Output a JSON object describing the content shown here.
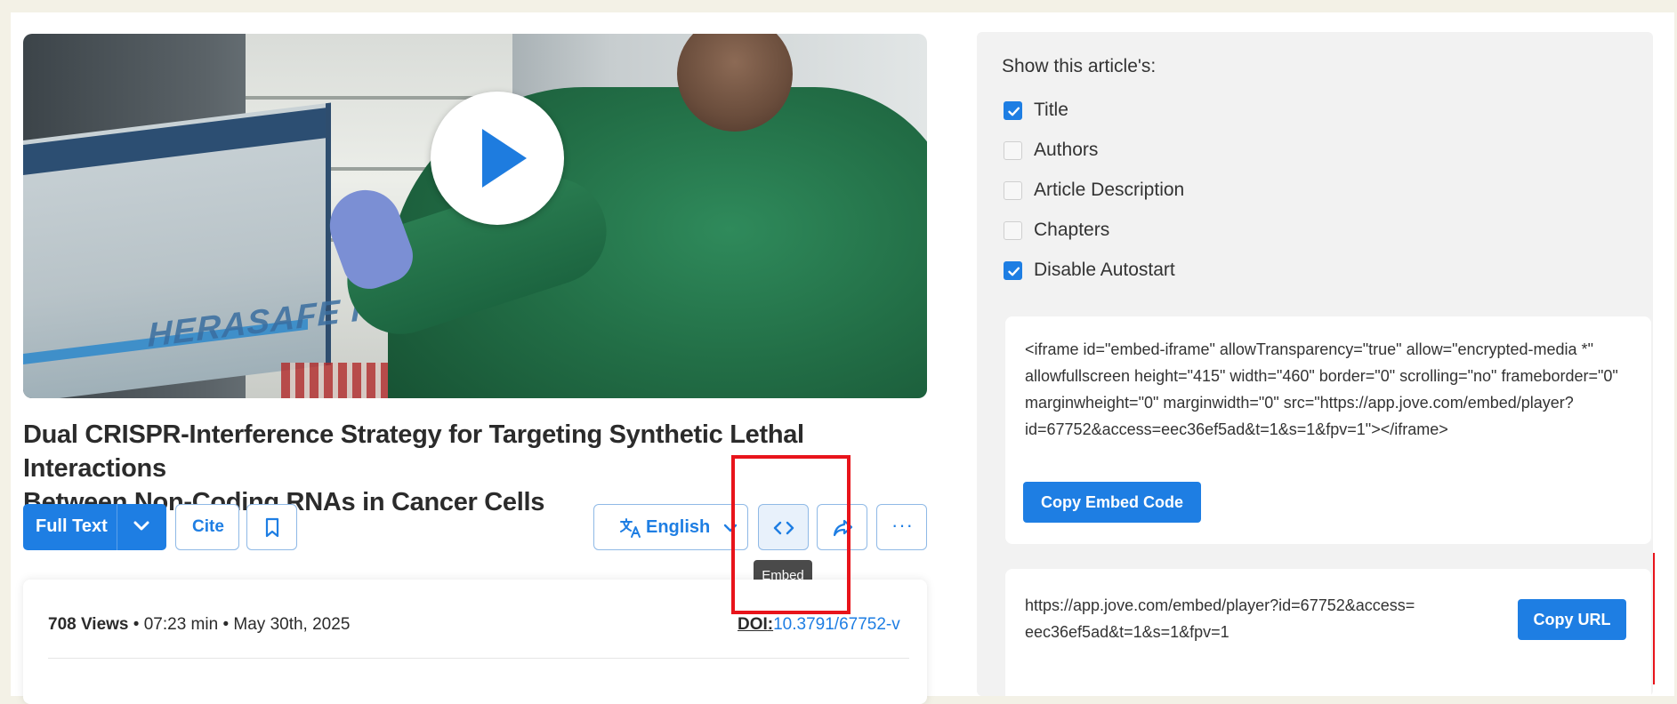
{
  "video": {
    "brand_text": "HERASAFE KSP",
    "play_icon": "play-icon"
  },
  "article": {
    "title_line1": "Dual CRISPR-Interference Strategy for Targeting Synthetic Lethal Interactions",
    "title_line2": "Between Non-Coding RNAs in Cancer Cells"
  },
  "toolbar": {
    "full_text": "Full Text",
    "cite": "Cite",
    "language": "English",
    "embed_tooltip": "Embed",
    "more": "···"
  },
  "meta": {
    "views": "708 Views",
    "separator": "•",
    "duration": "07:23 min",
    "date": "May 30th, 2025",
    "doi_label": "DOI",
    "doi_sep": ":",
    "doi_value": "10.3791/67752-v"
  },
  "embed_panel": {
    "heading": "Show this article's:",
    "options": [
      {
        "label": "Title",
        "checked": true
      },
      {
        "label": "Authors",
        "checked": false
      },
      {
        "label": "Article Description",
        "checked": false
      },
      {
        "label": "Chapters",
        "checked": false
      },
      {
        "label": "Disable Autostart",
        "checked": true
      }
    ],
    "embed_code": "<iframe id=\"embed-iframe\" allowTransparency=\"true\" allow=\"encrypted-media *\" allowfullscreen height=\"415\" width=\"460\" border=\"0\" scrolling=\"no\" frameborder=\"0\" marginwheight=\"0\" marginwidth=\"0\" src=\"https://app.jove.com/embed/player?id=67752&access=eec36ef5ad&t=1&s=1&fpv=1\"></iframe>",
    "copy_embed_label": "Copy Embed Code",
    "url": "https://app.jove.com/embed/player?id=67752&access=eec36ef5ad&t=1&s=1&fpv=1",
    "copy_url_label": "Copy URL"
  },
  "colors": {
    "accent": "#1e7ee3",
    "highlight": "#e8141b",
    "checkbox_on": "#1e7ee3"
  }
}
